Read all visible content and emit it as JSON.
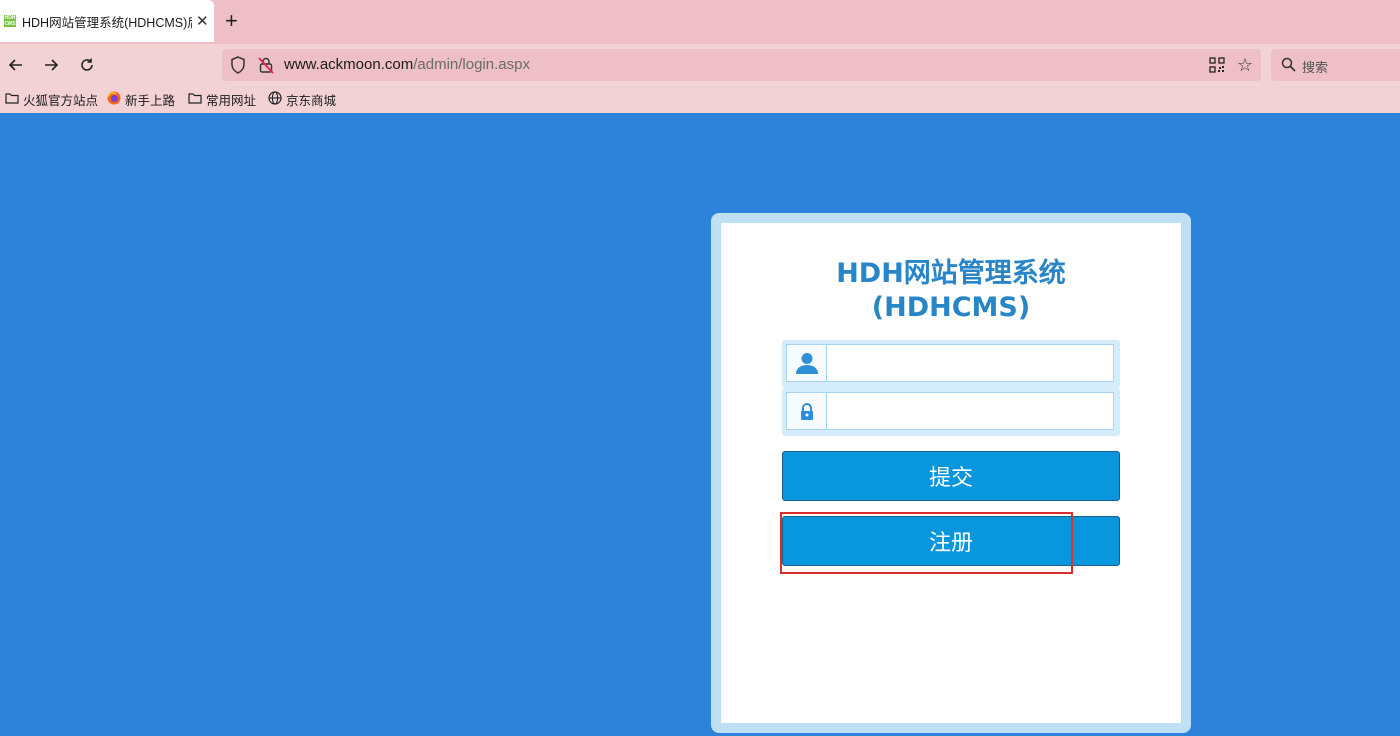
{
  "browser": {
    "tab_title": "HDH网站管理系统(HDHCMS)后台",
    "favicon_text": "HDH CMS",
    "url_host": "www.ackmoon.com",
    "url_path": "/admin/login.aspx",
    "search_placeholder": "搜索",
    "bookmarks": [
      {
        "label": "火狐官方站点",
        "icon": "folder-icon"
      },
      {
        "label": "新手上路",
        "icon": "firefox-icon"
      },
      {
        "label": "常用网址",
        "icon": "folder-icon"
      },
      {
        "label": "京东商城",
        "icon": "globe-icon"
      }
    ]
  },
  "login": {
    "title_line1": "HDH网站管理系统",
    "title_line2": "(HDHCMS)",
    "username_icon": "user-icon",
    "password_icon": "lock-icon",
    "username_value": "",
    "password_value": "",
    "submit_label": "提交",
    "register_label": "注册"
  },
  "colors": {
    "background": "#2d82d9",
    "title": "#2886c8",
    "button": "#0897dc",
    "highlight": "#d9302c"
  }
}
